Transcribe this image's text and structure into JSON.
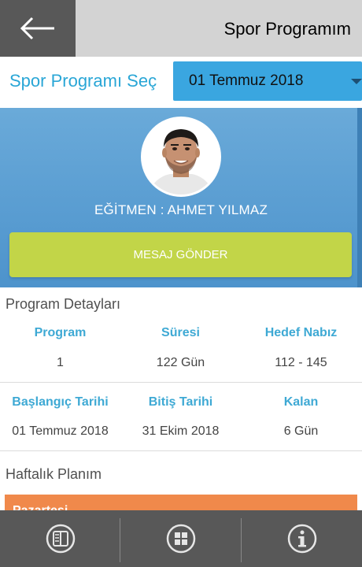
{
  "header": {
    "title": "Spor Programım",
    "back_icon": "arrow-left-icon"
  },
  "selector": {
    "label": "Spor Programı Seç",
    "value": "01 Temmuz 2018"
  },
  "trainer": {
    "name": "EĞİTMEN : AHMET YILMAZ",
    "message_button": "MESAJ GÖNDER"
  },
  "details": {
    "title": "Program Detayları",
    "row1": {
      "headers": [
        "Program",
        "Süresi",
        "Hedef Nabız"
      ],
      "values": [
        "1",
        "122 Gün",
        "112 - 145"
      ]
    },
    "row2": {
      "headers": [
        "Başlangıç Tarihi",
        "Bitiş Tarihi",
        "Kalan"
      ],
      "values": [
        "01 Temmuz 2018",
        "31 Ekim 2018",
        "6 Gün"
      ]
    }
  },
  "weekly": {
    "title": "Haftalık Planım",
    "first_day": "Pazartesi"
  },
  "bottom_nav": {
    "icons": [
      "book-icon",
      "grid-icon",
      "info-icon"
    ]
  },
  "colors": {
    "accent_blue": "#3aa6e0",
    "header_gray": "#d3d3d3",
    "dark_gray": "#585858",
    "lime_button": "#c2d548",
    "orange": "#f0894b",
    "label_blue": "#3ea9d4"
  }
}
